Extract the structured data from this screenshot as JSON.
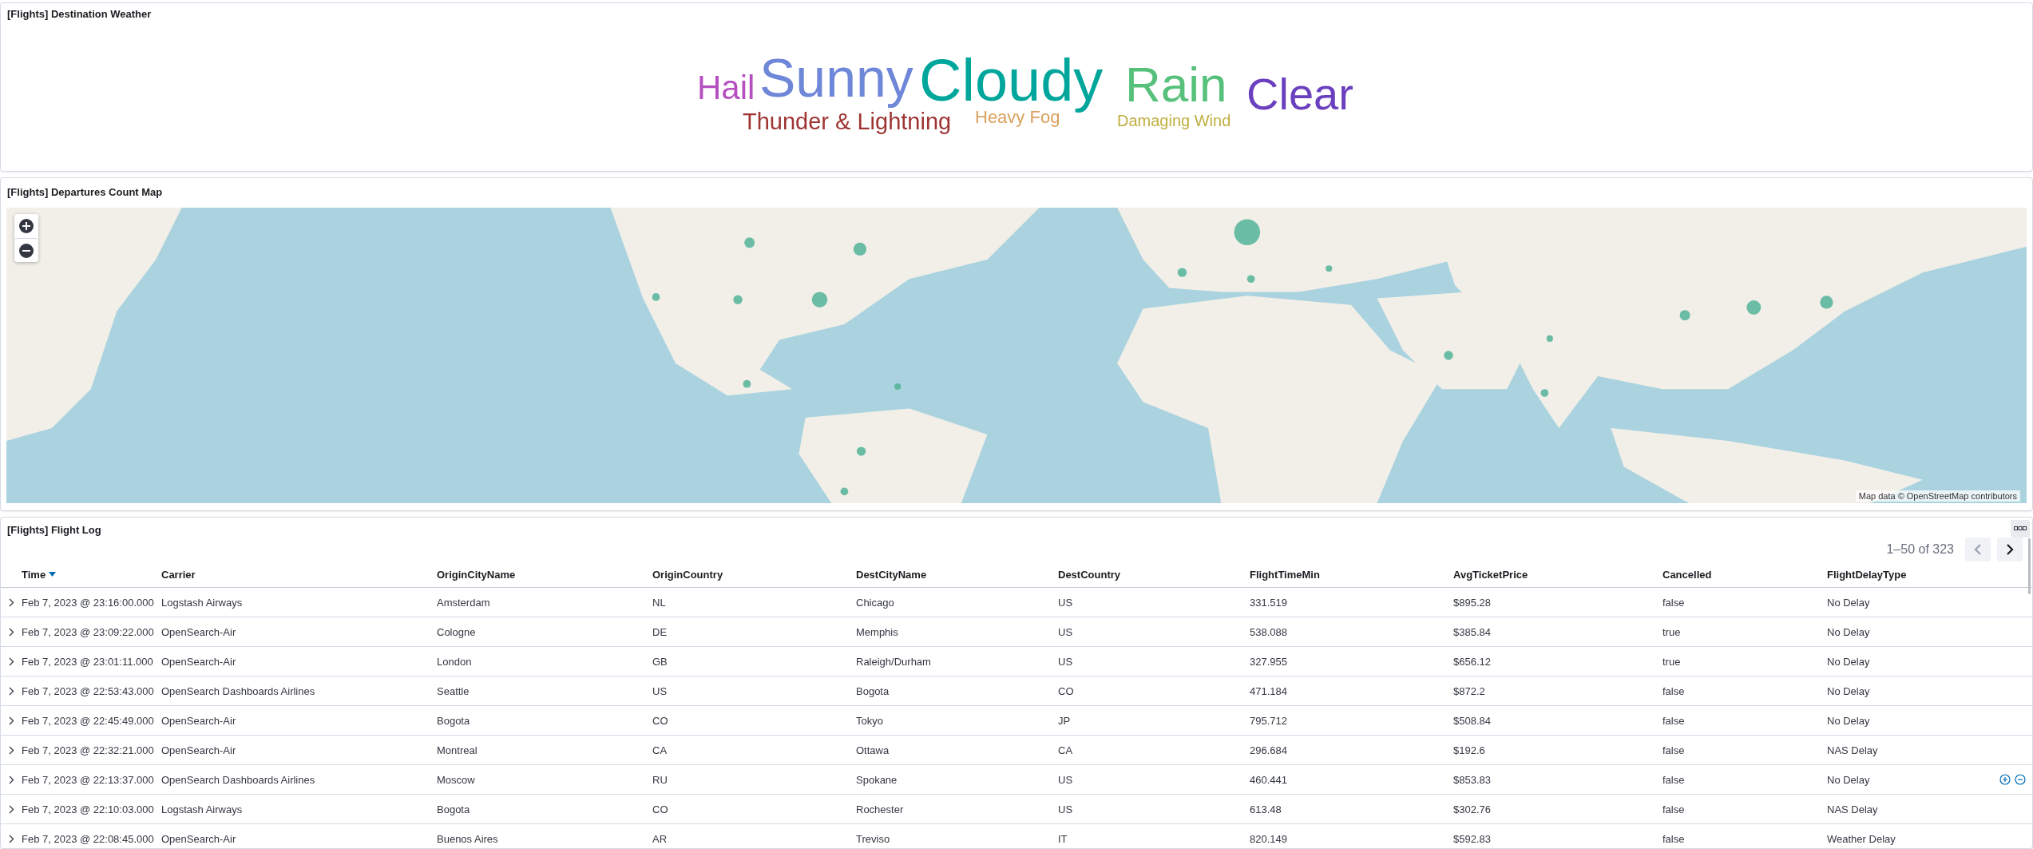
{
  "weather_panel": {
    "title": "[Flights] Destination Weather",
    "words": [
      {
        "text": "Hail",
        "color": "#b54fc0"
      },
      {
        "text": "Sunny",
        "color": "#6f87d8"
      },
      {
        "text": "Cloudy",
        "color": "#00a69b"
      },
      {
        "text": "Rain",
        "color": "#57c17b"
      },
      {
        "text": "Clear",
        "color": "#6a40bf"
      },
      {
        "text": "Thunder & Lightning",
        "color": "#9e3533"
      },
      {
        "text": "Heavy Fog",
        "color": "#daa05d"
      },
      {
        "text": "Damaging Wind",
        "color": "#bfaf40"
      }
    ]
  },
  "map_panel": {
    "title": "[Flights] Departures Count Map",
    "attribution": "Map data © OpenStreetMap contributors"
  },
  "log_panel": {
    "title": "[Flights] Flight Log",
    "pagination": {
      "range": "1–50 of 323",
      "prev_disabled": true,
      "next_disabled": false
    },
    "table": {
      "columns": [
        {
          "label": "Time",
          "sorted": true
        },
        {
          "label": "Carrier",
          "sorted": false
        },
        {
          "label": "OriginCityName",
          "sorted": false
        },
        {
          "label": "OriginCountry",
          "sorted": false
        },
        {
          "label": "DestCityName",
          "sorted": false
        },
        {
          "label": "DestCountry",
          "sorted": false
        },
        {
          "label": "FlightTimeMin",
          "sorted": false
        },
        {
          "label": "AvgTicketPrice",
          "sorted": false
        },
        {
          "label": "Cancelled",
          "sorted": false
        },
        {
          "label": "FlightDelayType",
          "sorted": false
        }
      ],
      "rows": [
        {
          "hovered": false,
          "cells": [
            "Feb 7, 2023 @ 23:16:00.000",
            "Logstash Airways",
            "Amsterdam",
            "NL",
            "Chicago",
            "US",
            "331.519",
            "$895.28",
            "false",
            "No Delay"
          ]
        },
        {
          "hovered": false,
          "cells": [
            "Feb 7, 2023 @ 23:09:22.000",
            "OpenSearch-Air",
            "Cologne",
            "DE",
            "Memphis",
            "US",
            "538.088",
            "$385.84",
            "true",
            "No Delay"
          ]
        },
        {
          "hovered": false,
          "cells": [
            "Feb 7, 2023 @ 23:01:11.000",
            "OpenSearch-Air",
            "London",
            "GB",
            "Raleigh/Durham",
            "US",
            "327.955",
            "$656.12",
            "true",
            "No Delay"
          ]
        },
        {
          "hovered": false,
          "cells": [
            "Feb 7, 2023 @ 22:53:43.000",
            "OpenSearch Dashboards Airlines",
            "Seattle",
            "US",
            "Bogota",
            "CO",
            "471.184",
            "$872.2",
            "false",
            "No Delay"
          ]
        },
        {
          "hovered": false,
          "cells": [
            "Feb 7, 2023 @ 22:45:49.000",
            "OpenSearch-Air",
            "Bogota",
            "CO",
            "Tokyo",
            "JP",
            "795.712",
            "$508.84",
            "false",
            "No Delay"
          ]
        },
        {
          "hovered": false,
          "cells": [
            "Feb 7, 2023 @ 22:32:21.000",
            "OpenSearch-Air",
            "Montreal",
            "CA",
            "Ottawa",
            "CA",
            "296.684",
            "$192.6",
            "false",
            "NAS Delay"
          ]
        },
        {
          "hovered": true,
          "cells": [
            "Feb 7, 2023 @ 22:13:37.000",
            "OpenSearch Dashboards Airlines",
            "Moscow",
            "RU",
            "Spokane",
            "US",
            "460.441",
            "$853.83",
            "false",
            "No Delay"
          ]
        },
        {
          "hovered": false,
          "cells": [
            "Feb 7, 2023 @ 22:10:03.000",
            "Logstash Airways",
            "Bogota",
            "CO",
            "Rochester",
            "US",
            "613.48",
            "$302.76",
            "false",
            "NAS Delay"
          ]
        },
        {
          "hovered": false,
          "cells": [
            "Feb 7, 2023 @ 22:08:45.000",
            "OpenSearch-Air",
            "Buenos Aires",
            "AR",
            "Treviso",
            "IT",
            "820.149",
            "$592.83",
            "false",
            "Weather Delay"
          ]
        }
      ]
    }
  }
}
